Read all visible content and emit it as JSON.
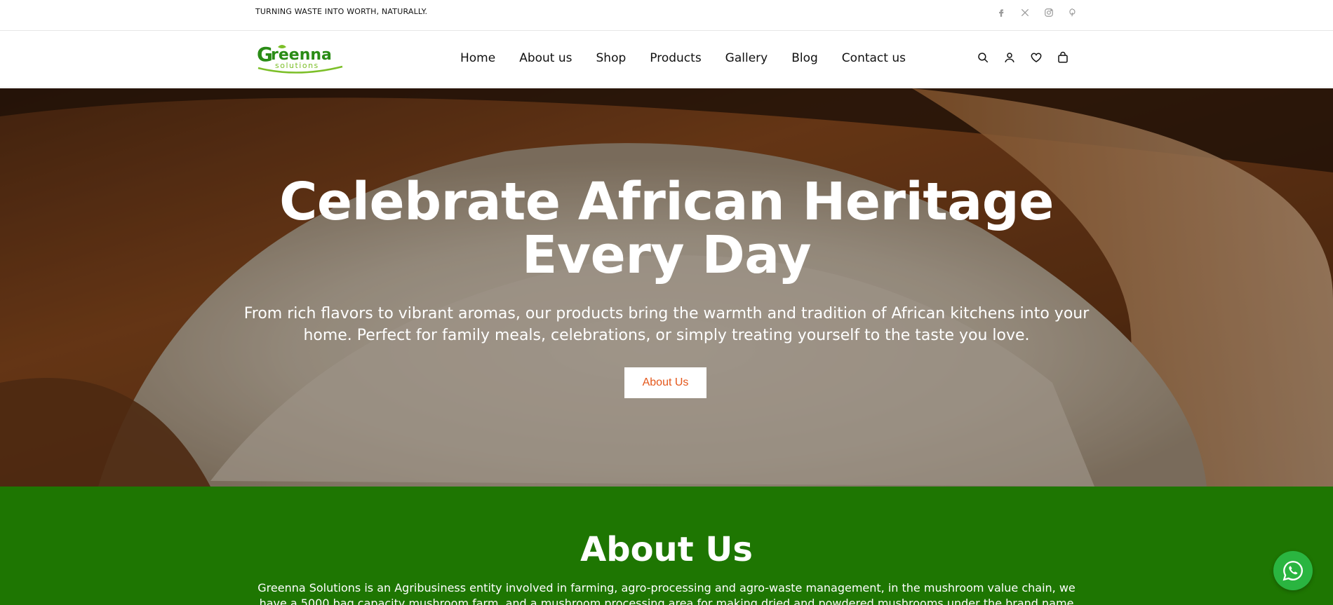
{
  "topbar": {
    "tagline": "TURNING WASTE INTO WORTH, NATURALLY.",
    "socials": [
      "facebook-icon",
      "x-twitter-icon",
      "instagram-icon",
      "pinterest-icon"
    ]
  },
  "header": {
    "logo": {
      "brand": "Greenna",
      "sub": "solutions"
    },
    "nav": [
      "Home",
      "About us",
      "Shop",
      "Products",
      "Gallery",
      "Blog",
      "Contact us"
    ],
    "icons": [
      "search-icon",
      "account-icon",
      "wishlist-icon",
      "cart-icon"
    ]
  },
  "hero": {
    "title": "Celebrate African Heritage Every Day",
    "subtitle": "From rich flavors to vibrant aromas, our products bring the warmth and tradition of African kitchens into your home. Perfect for family meals, celebrations, or simply treating yourself to the taste you love.",
    "button": "About Us"
  },
  "about": {
    "title": "About Us",
    "text": "Greenna Solutions is an Agribusiness entity involved in farming, agro-processing and agro-waste management, in the mushroom value chain, we have a 5000 bag capacity mushroom farm, and a mushroom processing area for making dried and powdered mushrooms under the brand name 'GoldenArk mushrooms'. GoldenArk"
  },
  "colors": {
    "brand_green": "#1e7602",
    "accent_orange": "#e4571b",
    "whatsapp_green": "#2ab540"
  }
}
